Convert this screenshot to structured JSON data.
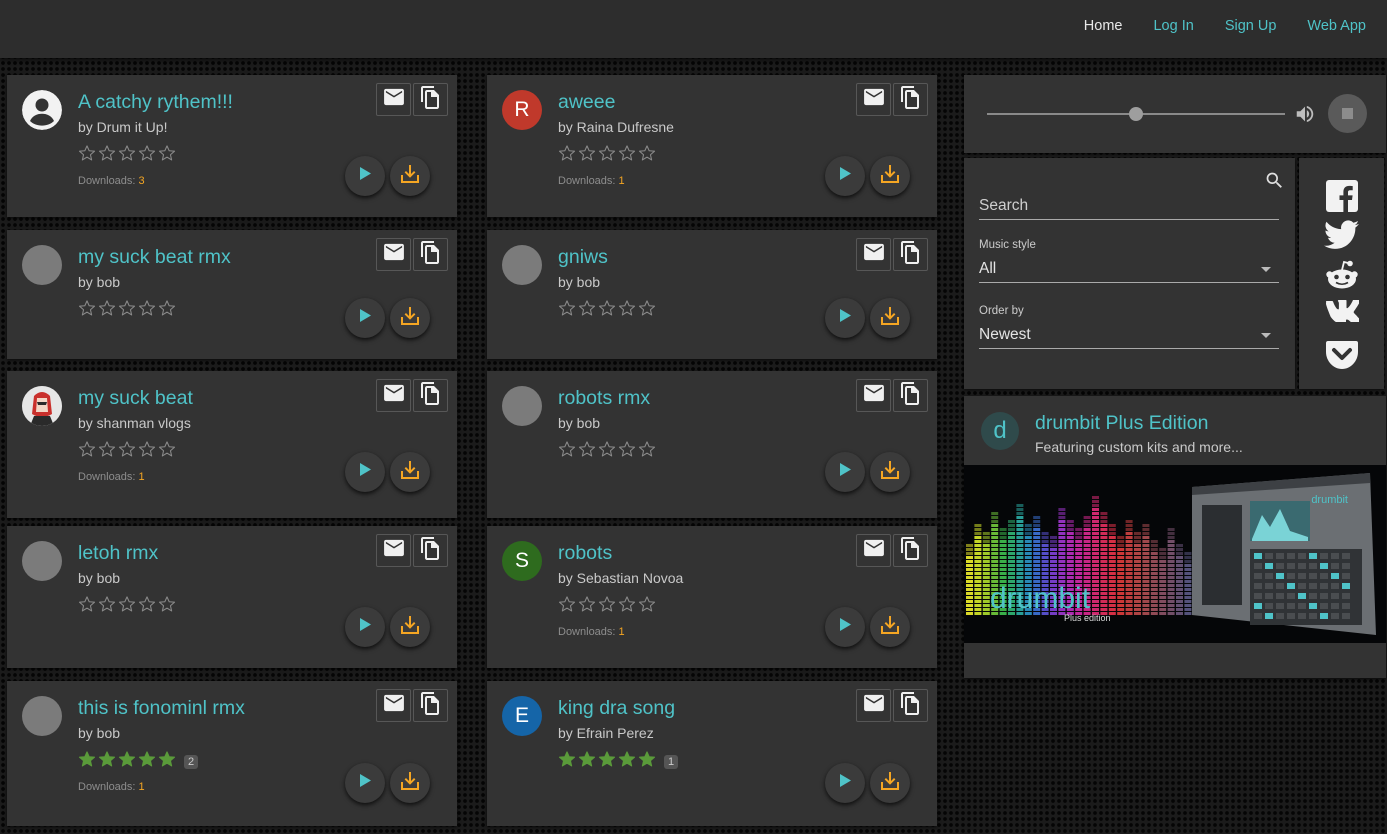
{
  "nav": [
    {
      "label": "Home",
      "active": true
    },
    {
      "label": "Log In",
      "active": false
    },
    {
      "label": "Sign Up",
      "active": false
    },
    {
      "label": "Web App",
      "active": false
    }
  ],
  "downloads_label": "Downloads:",
  "songs": [
    {
      "title": "A catchy rythem!!!",
      "author": "by Drum it Up!",
      "avatar": {
        "type": "person-icon"
      },
      "stars": 0,
      "rating_count": "",
      "downloads": "3"
    },
    {
      "title": "aweee",
      "author": "by Raina Dufresne",
      "avatar": {
        "type": "letter",
        "letter": "R",
        "color": "#c0392b"
      },
      "stars": 0,
      "rating_count": "",
      "downloads": "1"
    },
    {
      "title": "my suck beat rmx",
      "author": "by bob",
      "avatar": {
        "type": "blank"
      },
      "stars": 0,
      "rating_count": "",
      "downloads": ""
    },
    {
      "title": "gniws",
      "author": "by bob",
      "avatar": {
        "type": "blank"
      },
      "stars": 0,
      "rating_count": "",
      "downloads": ""
    },
    {
      "title": "my suck beat",
      "author": "by shanman vlogs",
      "avatar": {
        "type": "photo"
      },
      "stars": 0,
      "rating_count": "",
      "downloads": "1"
    },
    {
      "title": "robots rmx",
      "author": "by bob",
      "avatar": {
        "type": "blank"
      },
      "stars": 0,
      "rating_count": "",
      "downloads": ""
    },
    {
      "title": "letoh rmx",
      "author": "by bob",
      "avatar": {
        "type": "blank"
      },
      "stars": 0,
      "rating_count": "",
      "downloads": ""
    },
    {
      "title": "robots",
      "author": "by Sebastian Novoa",
      "avatar": {
        "type": "letter",
        "letter": "S",
        "color": "#2e6b1e"
      },
      "stars": 0,
      "rating_count": "",
      "downloads": "1"
    },
    {
      "title": "this is fonominl rmx",
      "author": "by bob",
      "avatar": {
        "type": "blank"
      },
      "stars": 5,
      "rating_count": "2",
      "downloads": "1"
    },
    {
      "title": "king dra song",
      "author": "by Efrain Perez",
      "avatar": {
        "type": "letter",
        "letter": "E",
        "color": "#1565a8"
      },
      "stars": 5,
      "rating_count": "1",
      "downloads": ""
    }
  ],
  "player": {
    "volume": 0.5,
    "playing": false
  },
  "search": {
    "placeholder": "Search",
    "value": ""
  },
  "filters": {
    "music_style_label": "Music style",
    "music_style_value": "All",
    "order_label": "Order by",
    "order_value": "Newest"
  },
  "social": [
    "facebook-icon",
    "twitter-icon",
    "reddit-icon",
    "vk-icon",
    "pocket-icon"
  ],
  "promo": {
    "logo_letter": "d",
    "title": "drumbit Plus Edition",
    "subtitle": "Featuring custom kits and more...",
    "image_brand": "drumbit",
    "image_edition": "Plus edition"
  },
  "colors": {
    "accent": "#4fc3c8",
    "download": "#f5a623",
    "star_filled": "#5a9a3a"
  }
}
